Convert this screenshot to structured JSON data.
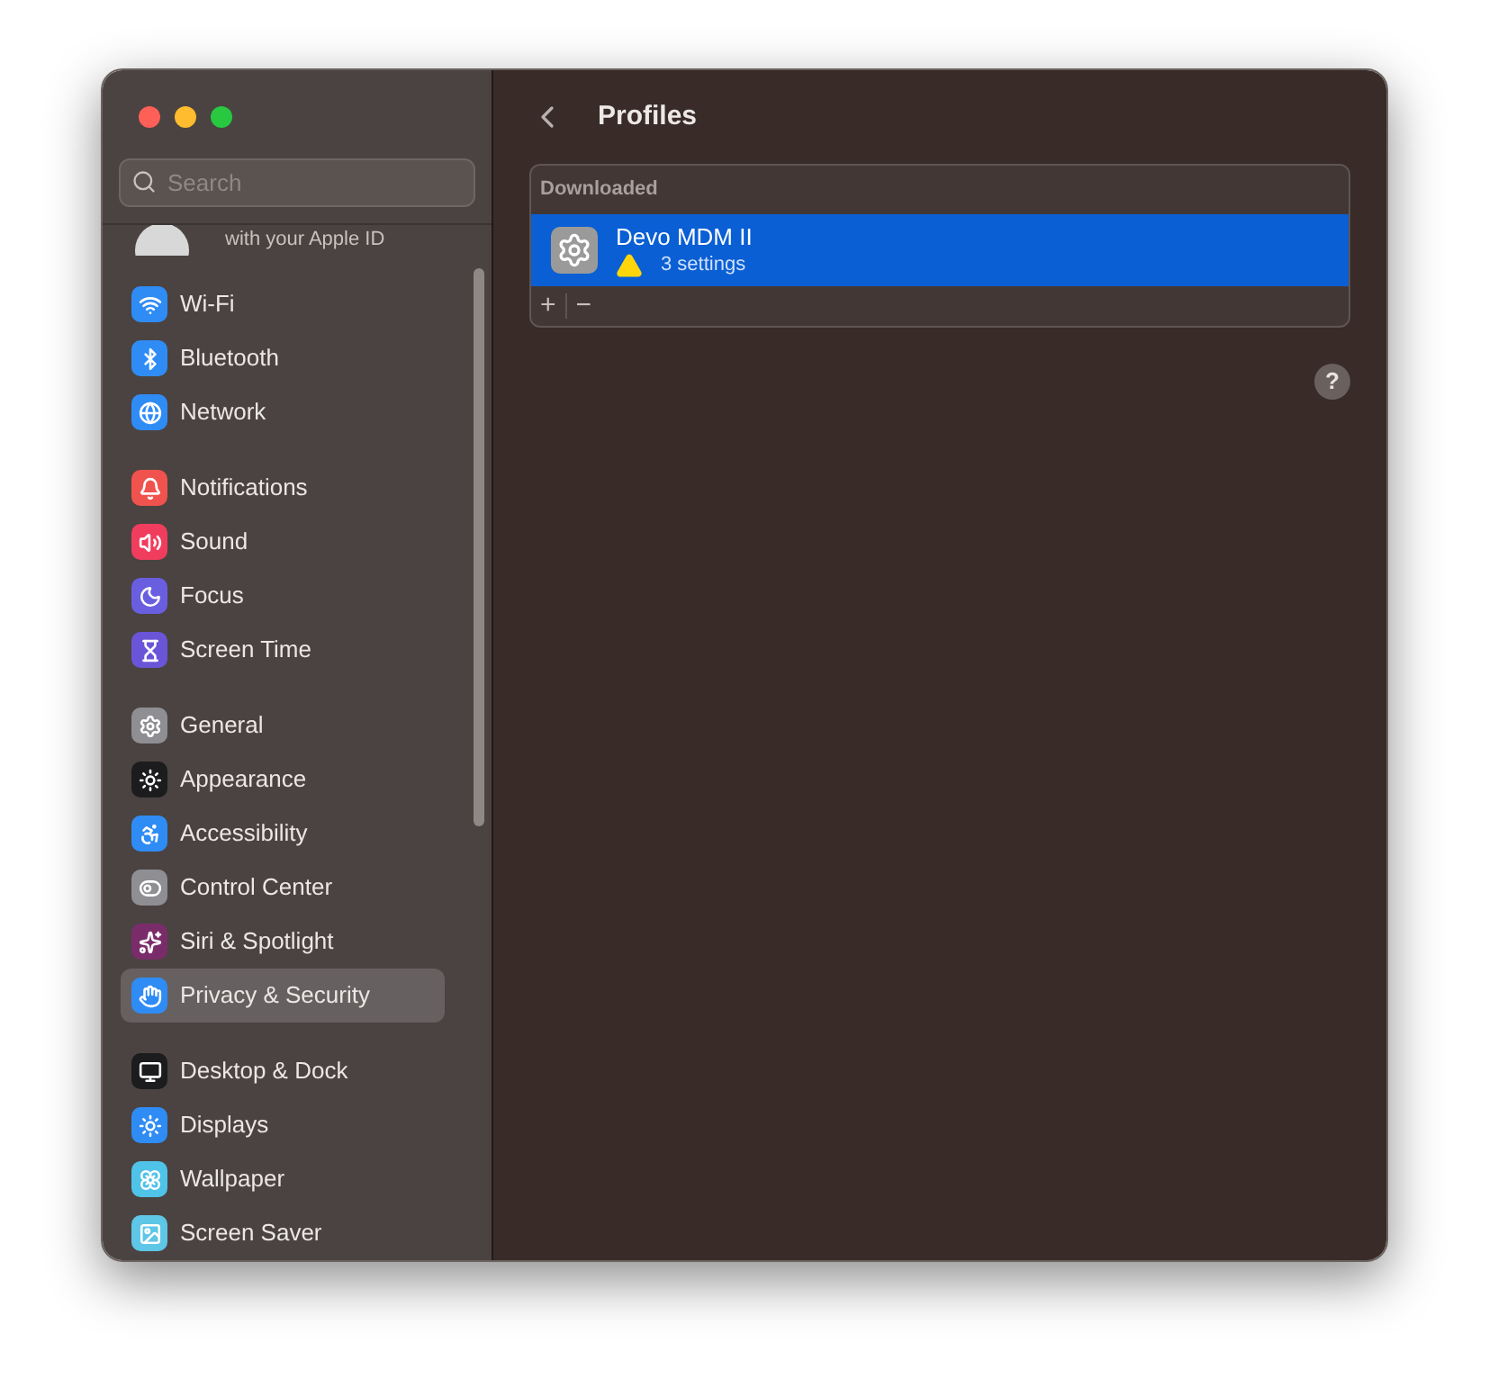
{
  "window": {
    "title": "Profiles"
  },
  "sidebar": {
    "search": {
      "placeholder": "Search"
    },
    "account_caption": "with your Apple ID",
    "groups": [
      [
        {
          "label": "Wi-Fi",
          "color": "#2f8cf5",
          "selected": false
        },
        {
          "label": "Bluetooth",
          "color": "#2f8cf5",
          "selected": false
        },
        {
          "label": "Network",
          "color": "#2f8cf5",
          "selected": false
        }
      ],
      [
        {
          "label": "Notifications",
          "color": "#f0534d",
          "selected": false
        },
        {
          "label": "Sound",
          "color": "#f03d5e",
          "selected": false
        },
        {
          "label": "Focus",
          "color": "#6a5ee0",
          "selected": false
        },
        {
          "label": "Screen Time",
          "color": "#6a55d8",
          "selected": false
        }
      ],
      [
        {
          "label": "General",
          "color": "#8e8e93",
          "selected": false
        },
        {
          "label": "Appearance",
          "color": "#1c1c1e",
          "selected": false
        },
        {
          "label": "Accessibility",
          "color": "#2f8cf5",
          "selected": false
        },
        {
          "label": "Control Center",
          "color": "#8e8e93",
          "selected": false
        },
        {
          "label": "Siri & Spotlight",
          "color": "#7a2c6a",
          "selected": false
        },
        {
          "label": "Privacy & Security",
          "color": "#2f8cf5",
          "selected": true
        }
      ],
      [
        {
          "label": "Desktop & Dock",
          "color": "#1c1c1e",
          "selected": false
        },
        {
          "label": "Displays",
          "color": "#2f8cf5",
          "selected": false
        },
        {
          "label": "Wallpaper",
          "color": "#4fc3e8",
          "selected": false
        },
        {
          "label": "Screen Saver",
          "color": "#5ec6e6",
          "selected": false
        }
      ]
    ]
  },
  "profiles": {
    "section": "Downloaded",
    "items": [
      {
        "name": "Devo MDM II",
        "detail": "3 settings",
        "warning": true,
        "selected": true
      }
    ],
    "add": "+",
    "remove": "−"
  },
  "help": "?"
}
